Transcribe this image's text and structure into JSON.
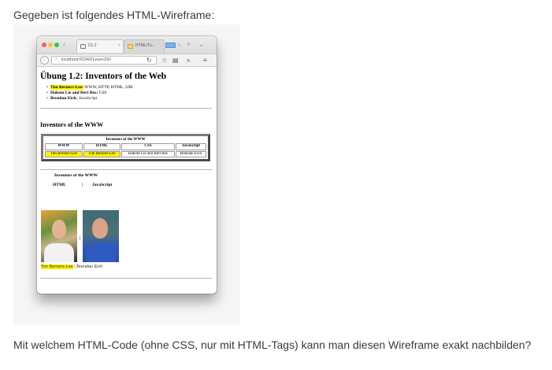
{
  "intro": "Gegeben ist folgendes HTML-Wireframe:",
  "question": "Mit welchem HTML-Code (ohne CSS, nur mit HTML-Tags) kann man diesen Wireframe exakt nachbilden?",
  "browser": {
    "tabs": [
      {
        "label": "Ü1.2",
        "close": "×"
      },
      {
        "label": "HTML/Tu...",
        "close": ""
      }
    ],
    "tab_overflow": "»",
    "new_tab": "+",
    "tab_menu": "⌄",
    "address": "localhost:63342/LearnJS/i",
    "back_glyph": "←",
    "info_glyph": "ⓘ",
    "reload_glyph": "↻",
    "bookmark_glyph": "☆",
    "reader_glyph": "▤",
    "more_glyph": "»",
    "menu_glyph": "≡",
    "nav_back_chevron": "‹",
    "nav_fwd_chevron": "›"
  },
  "page": {
    "h1": "Übung 1.2: Inventors of the Web",
    "list": [
      {
        "name": "Tim Berners-Lee:",
        "desc": " WWW, HTTP, HTML, URI",
        "highlight": true
      },
      {
        "name": "Hakom Lie and Bert Bos:",
        "desc": " CSS",
        "highlight": false
      },
      {
        "name": "Brendan Eich:",
        "desc": " JavaScript",
        "highlight": false
      }
    ],
    "h2": "Inventors of the WWW",
    "table": {
      "caption": "Inventors of the WWW",
      "headers": [
        "WWW",
        "HTML",
        "CSS",
        "JavaScript"
      ],
      "row": [
        "Tim Berners-Lee",
        "Tim Berners-Lee",
        "Hakom Lie and Bert Bos",
        "Brendan Eich"
      ],
      "highlight": "#fff200"
    },
    "gallery": {
      "title": "Inventors of the WWW",
      "col1": "HTML",
      "separator": "|",
      "col2": "JavaScript",
      "name1": "Tim Berners-Lee",
      "name_sep": " | ",
      "name2": "Brendan Eich"
    }
  }
}
